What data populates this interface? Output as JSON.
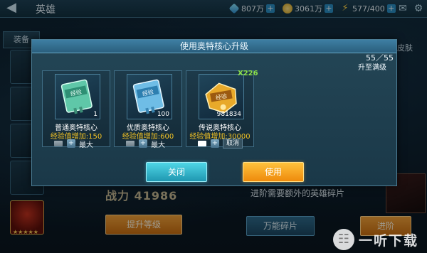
{
  "topbar": {
    "title": "英雄",
    "diamonds": "807万",
    "gold": "3061万",
    "energy": "577/400"
  },
  "left": {
    "tab_label": "装备"
  },
  "right": {
    "tab_label": "皮肤"
  },
  "background": {
    "power_text": "战力 41986",
    "hint": "进阶需要额外的英雄碎片",
    "upgrade_button": "提升等级",
    "shard_button": "万能碎片",
    "advance_button": "进阶"
  },
  "dialog": {
    "title": "使用奥特核心升级",
    "progress": "55／55",
    "progress_note": "升至满级",
    "items": [
      {
        "name": "普通奥特核心",
        "bonus": "经验值增加:150",
        "count": "1",
        "qty": "",
        "max": "最大"
      },
      {
        "name": "优质奥特核心",
        "bonus": "经验值增加:600",
        "count": "100",
        "qty": "",
        "max": "最大"
      },
      {
        "name": "传说奥特核心",
        "bonus": "经验值增加:30000",
        "count": "981834",
        "qty": "X226",
        "cancel": "取消"
      }
    ],
    "close_button": "关闭",
    "use_button": "使用"
  },
  "watermark": {
    "text": "一听下载"
  },
  "colors": {
    "dialog_bg": "#1a3848",
    "header": "#3e7fa3",
    "bonus": "#f2c224",
    "qty": "#8ce04b",
    "close_btn": "#2fb8d0",
    "use_btn": "#f5a020"
  }
}
